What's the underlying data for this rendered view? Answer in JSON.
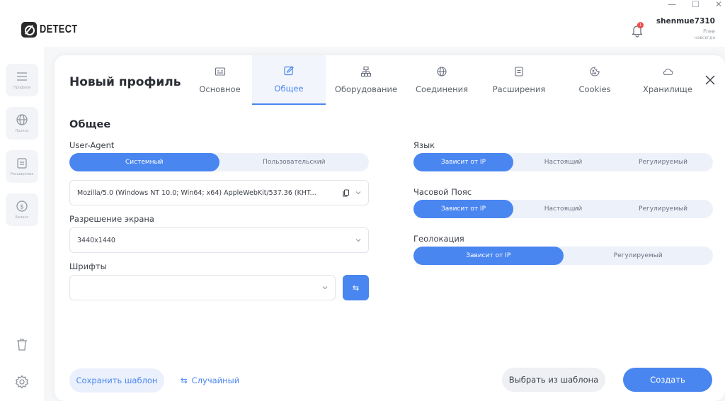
{
  "app": {
    "logo_text": "DETECT"
  },
  "window_controls": {
    "minimize": "—",
    "maximize": "☐",
    "close": "✕"
  },
  "header": {
    "notification_count": "1",
    "user_name": "shenmue7310",
    "plan": "Free",
    "plan_note": "навсегда"
  },
  "sidebar": {
    "items": [
      {
        "label": "Профили",
        "icon": "list-icon"
      },
      {
        "label": "Прокси",
        "icon": "globe-icon"
      },
      {
        "label": "Расширения",
        "icon": "window-icon"
      },
      {
        "label": "Баланс",
        "icon": "dollar-icon"
      }
    ]
  },
  "card": {
    "title": "Новый профиль",
    "tabs": [
      {
        "label": "Основное",
        "icon": "id-card-icon",
        "active": false
      },
      {
        "label": "Общее",
        "icon": "edit-icon",
        "active": true
      },
      {
        "label": "Оборудование",
        "icon": "hardware-icon",
        "active": false
      },
      {
        "label": "Соединения",
        "icon": "globe-icon",
        "active": false
      },
      {
        "label": "Расширения",
        "icon": "window-icon",
        "active": false
      },
      {
        "label": "Cookies",
        "icon": "cookie-icon",
        "active": false
      },
      {
        "label": "Хранилище",
        "icon": "cloud-icon",
        "active": false
      }
    ]
  },
  "general": {
    "section_title": "Общее",
    "user_agent": {
      "label": "User-Agent",
      "options": [
        "Системный",
        "Пользовательский"
      ],
      "selected": 0,
      "value": "Mozilla/5.0 (Windows NT 10.0; Win64; x64) AppleWebKit/537.36 (KHT..."
    },
    "resolution": {
      "label": "Разрешение экрана",
      "value": "3440x1440"
    },
    "fonts": {
      "label": "Шрифты",
      "value": "",
      "swap_glyph": "⇆"
    },
    "language": {
      "label": "Язык",
      "options": [
        "Зависит от IP",
        "Настоящий",
        "Регулируемый"
      ],
      "selected": 0
    },
    "timezone": {
      "label": "Часовой Пояс",
      "options": [
        "Зависит от IP",
        "Настоящий",
        "Регулируемый"
      ],
      "selected": 0
    },
    "geolocation": {
      "label": "Геолокация",
      "options": [
        "Зависит от IP",
        "Регулируемый"
      ],
      "selected": 0
    }
  },
  "footer": {
    "save_template": "Сохранить шаблон",
    "random": "Случайный",
    "random_glyph": "⇆",
    "choose_template": "Выбрать из шаблона",
    "create": "Создать"
  },
  "colors": {
    "accent": "#4a86f0",
    "segment_bg": "#edf1fa",
    "badge": "#f04848"
  }
}
